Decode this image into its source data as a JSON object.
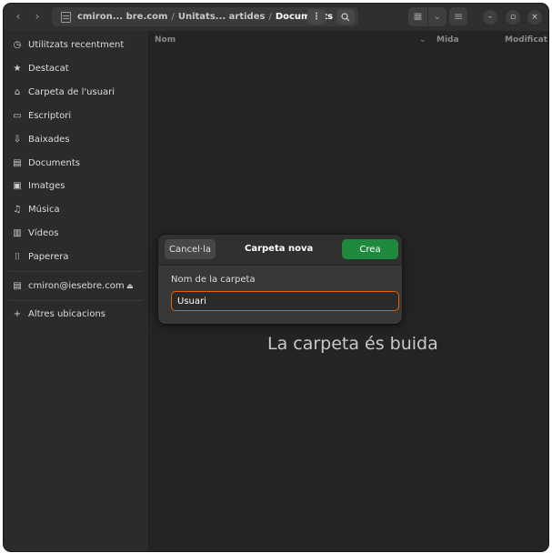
{
  "header": {
    "back_icon": "chevron-left-icon",
    "forward_icon": "chevron-right-icon",
    "path": {
      "root": "cmiron... bre.com",
      "separator": "/",
      "middle": "Unitats... artides",
      "current": "Documents"
    },
    "kebab_glyph": "⋮",
    "view_grid_glyph": "▦",
    "view_dropdown_glyph": "⌄",
    "menu_glyph": "≡",
    "minimize_glyph": "–",
    "maximize_glyph": "▫",
    "close_glyph": "×"
  },
  "sidebar": {
    "items": [
      {
        "label": "Utilitzats recentment",
        "icon": "clock-icon",
        "glyph": "◷"
      },
      {
        "label": "Destacat",
        "icon": "star-icon",
        "glyph": "★"
      },
      {
        "label": "Carpeta de l'usuari",
        "icon": "home-icon",
        "glyph": "⌂"
      },
      {
        "label": "Escriptori",
        "icon": "desktop-icon",
        "glyph": "▭"
      },
      {
        "label": "Baixades",
        "icon": "download-icon",
        "glyph": "⇩"
      },
      {
        "label": "Documents",
        "icon": "document-icon",
        "glyph": "▤"
      },
      {
        "label": "Imatges",
        "icon": "image-icon",
        "glyph": "▣"
      },
      {
        "label": "Música",
        "icon": "music-icon",
        "glyph": "♫"
      },
      {
        "label": "Vídeos",
        "icon": "video-icon",
        "glyph": "▥"
      },
      {
        "label": "Paperera",
        "icon": "trash-icon",
        "glyph": "⌷"
      }
    ],
    "network": {
      "label": "cmiron@iesebre.com",
      "icon": "network-drive-icon",
      "glyph": "▤",
      "eject": "⏏"
    },
    "other": {
      "label": "Altres ubicacions",
      "glyph": "+"
    }
  },
  "columns": {
    "name": "Nom",
    "size": "Mida",
    "modified": "Modificat",
    "sort_glyph": "⌄"
  },
  "main": {
    "empty_message": "La carpeta és buida"
  },
  "dialog": {
    "cancel_label": "Cancel·la",
    "title": "Carpeta nova",
    "create_label": "Crea",
    "field_label": "Nom de la carpeta",
    "field_value": "Usuari"
  },
  "colors": {
    "accent_create": "#1f8a3e",
    "focus_border": "#e66100"
  }
}
